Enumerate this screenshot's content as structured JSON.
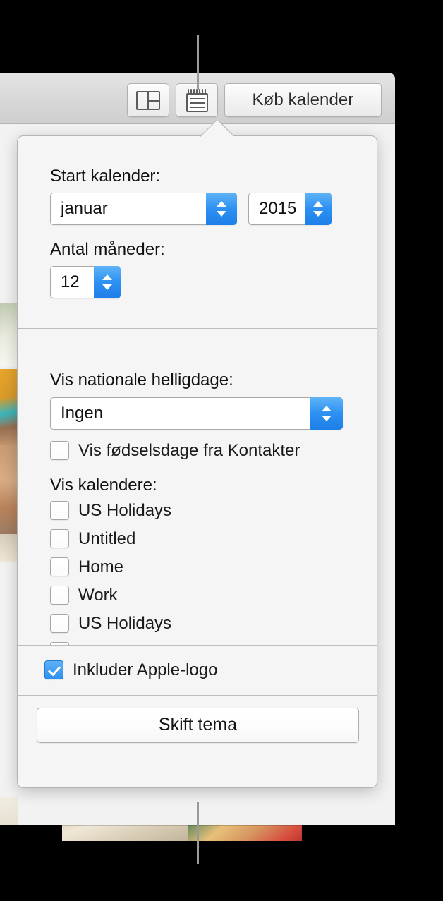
{
  "window": {
    "toolbar": {
      "buttons": [
        {
          "name": "layout-view-button",
          "icon": "layout-panel-icon",
          "label": ""
        },
        {
          "name": "calendar-settings-button",
          "icon": "notepad-icon",
          "label": ""
        },
        {
          "name": "buy-calendar-button",
          "icon": "",
          "label": "Køb kalender"
        }
      ]
    }
  },
  "popover": {
    "start_calendar": {
      "label": "Start kalender:",
      "month_value": "januar",
      "year_value": "2015"
    },
    "month_count": {
      "label": "Antal måneder:",
      "value": "12"
    },
    "holidays": {
      "label": "Vis nationale helligdage:",
      "value": "Ingen"
    },
    "birthdays": {
      "label": "Vis fødselsdage fra Kontakter",
      "checked": false
    },
    "calendars": {
      "label": "Vis kalendere:",
      "items": [
        {
          "label": "US Holidays",
          "checked": false
        },
        {
          "label": "Untitled",
          "checked": false
        },
        {
          "label": "Home",
          "checked": false
        },
        {
          "label": "Work",
          "checked": false
        },
        {
          "label": "US Holidays",
          "checked": false
        },
        {
          "label": "",
          "checked": false
        }
      ]
    },
    "apple_logo": {
      "label": "Inkluder Apple-logo",
      "checked": true
    },
    "change_theme": {
      "label": "Skift tema"
    }
  },
  "colors": {
    "accent": "#2d90f2",
    "popover_bg": "#f5f5f5",
    "toolbar_bg": "#d7d7d7",
    "text": "#111111",
    "divider": "#bcbcbc",
    "leader_line": "#9a9a9a"
  }
}
